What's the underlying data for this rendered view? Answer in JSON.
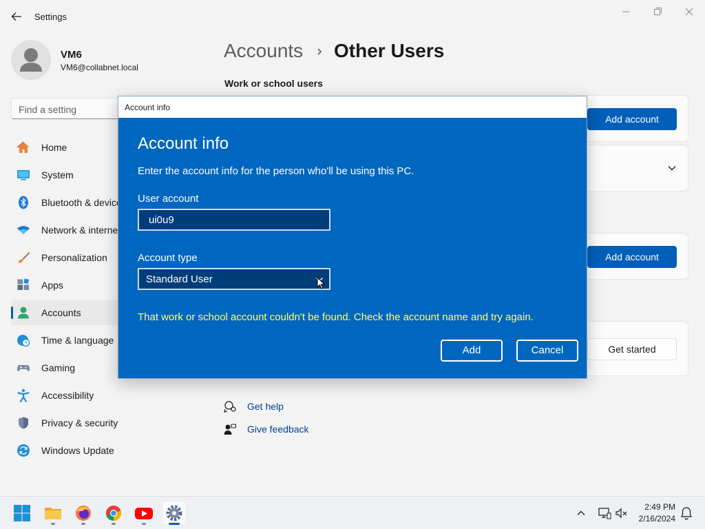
{
  "window": {
    "title": "Settings"
  },
  "profile": {
    "name": "VM6",
    "email": "VM6@collabnet.local"
  },
  "search": {
    "placeholder": "Find a setting"
  },
  "sidebar": {
    "items": [
      {
        "label": "Home",
        "icon": "home-icon"
      },
      {
        "label": "System",
        "icon": "monitor-icon"
      },
      {
        "label": "Bluetooth & devices",
        "icon": "bluetooth-icon"
      },
      {
        "label": "Network & internet",
        "icon": "wifi-icon"
      },
      {
        "label": "Personalization",
        "icon": "brush-icon"
      },
      {
        "label": "Apps",
        "icon": "apps-icon"
      },
      {
        "label": "Accounts",
        "icon": "person-icon",
        "active": true
      },
      {
        "label": "Time & language",
        "icon": "globe-clock-icon"
      },
      {
        "label": "Gaming",
        "icon": "gamepad-icon"
      },
      {
        "label": "Accessibility",
        "icon": "accessibility-icon"
      },
      {
        "label": "Privacy & security",
        "icon": "shield-icon"
      },
      {
        "label": "Windows Update",
        "icon": "update-icon"
      }
    ]
  },
  "main": {
    "breadcrumb_parent": "Accounts",
    "breadcrumb_current": "Other Users",
    "section_work": "Work or school users",
    "add_account_label_1": "Add account",
    "add_account_label_2": "Add account",
    "get_started_label": "Get started",
    "help_label": "Get help",
    "feedback_label": "Give feedback"
  },
  "dialog": {
    "window_title": "Account info",
    "heading": "Account info",
    "description": "Enter the account info for the person who'll be using this PC.",
    "user_account_label": "User account",
    "user_account_value": "ui0u9",
    "account_type_label": "Account type",
    "account_type_value": "Standard User",
    "error": "That work or school account couldn't be found. Check the account name and try again.",
    "add_label": "Add",
    "cancel_label": "Cancel"
  },
  "taskbar": {
    "apps": [
      "start-icon",
      "file-explorer-icon",
      "firefox-icon",
      "chrome-icon",
      "youtube-icon",
      "settings-icon"
    ],
    "time": "2:49 PM",
    "date": "2/16/2024"
  },
  "colors": {
    "accent": "#005fb8",
    "dialog_bg": "#0067c0",
    "error_text": "#ffff66"
  }
}
